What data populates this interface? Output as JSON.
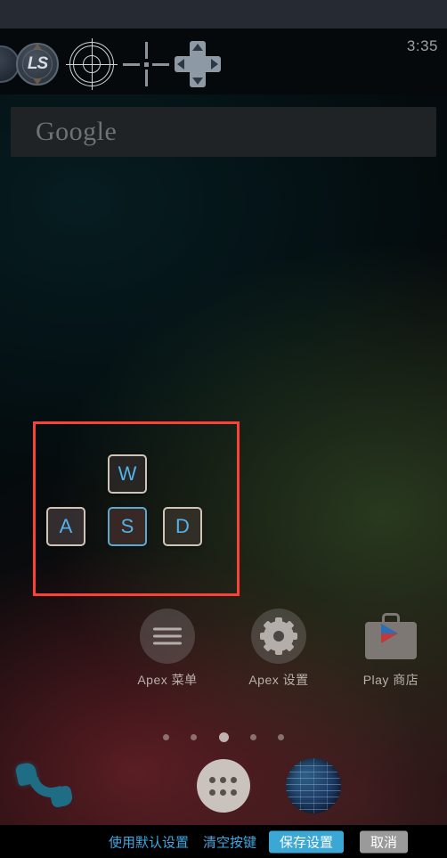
{
  "statusbar": {
    "time": "3:35"
  },
  "toolbar": {
    "icons": [
      {
        "name": "left-stick-partial-icon",
        "label": ""
      },
      {
        "name": "left-stick-icon",
        "label": "LS"
      },
      {
        "name": "aim-crosshair-icon",
        "label": ""
      },
      {
        "name": "mouse-look-crosshair-icon",
        "label": ""
      },
      {
        "name": "dpad-icon",
        "label": ""
      }
    ]
  },
  "widget": {
    "google_label": "Google"
  },
  "keymap": {
    "keys": [
      {
        "label": "W",
        "selected": false
      },
      {
        "label": "A",
        "selected": false
      },
      {
        "label": "S",
        "selected": true
      },
      {
        "label": "D",
        "selected": false
      }
    ],
    "selection_color": "#ff4036",
    "key_text_color": "#54b2e8",
    "selected_border_color": "#5ba9cf"
  },
  "apps": [
    {
      "label": "Apex 菜单",
      "icon": "hamburger-menu-icon"
    },
    {
      "label": "Apex 设置",
      "icon": "gear-icon"
    },
    {
      "label": "Play 商店",
      "icon": "play-store-icon"
    }
  ],
  "pager": {
    "count": 5,
    "active_index": 2
  },
  "dock": [
    {
      "name": "phone-icon"
    },
    {
      "name": "app-drawer-icon"
    },
    {
      "name": "browser-globe-icon"
    }
  ],
  "actionbar": {
    "use_default": "使用默认设置",
    "clear_keys": "清空按键",
    "save": "保存设置",
    "cancel": "取消",
    "link_color": "#3fa8e0",
    "save_color": "#3ba7d4",
    "cancel_color": "#9a9a9a"
  }
}
